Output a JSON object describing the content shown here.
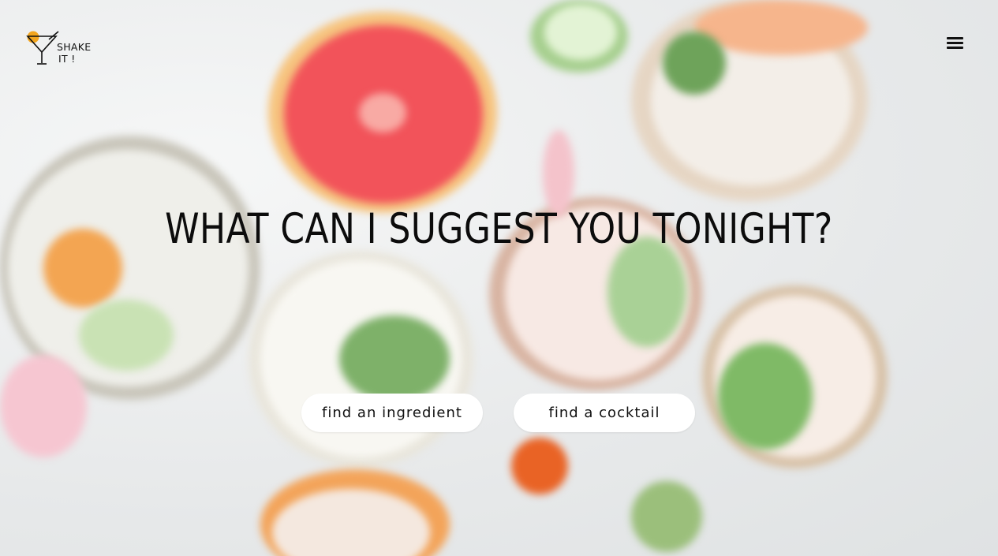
{
  "logo": {
    "line1": "SHAKE",
    "line2": "IT !",
    "icon": "cocktail-glass-icon",
    "accent_color": "#f2a51f"
  },
  "menu": {
    "icon": "hamburger-menu-icon"
  },
  "hero": {
    "headline": "WHAT CAN I SUGGEST YOU TONIGHT?",
    "background": "blurred-cocktails-photo"
  },
  "actions": {
    "ingredient_label": "find an ingredient",
    "cocktail_label": "find a cocktail"
  }
}
